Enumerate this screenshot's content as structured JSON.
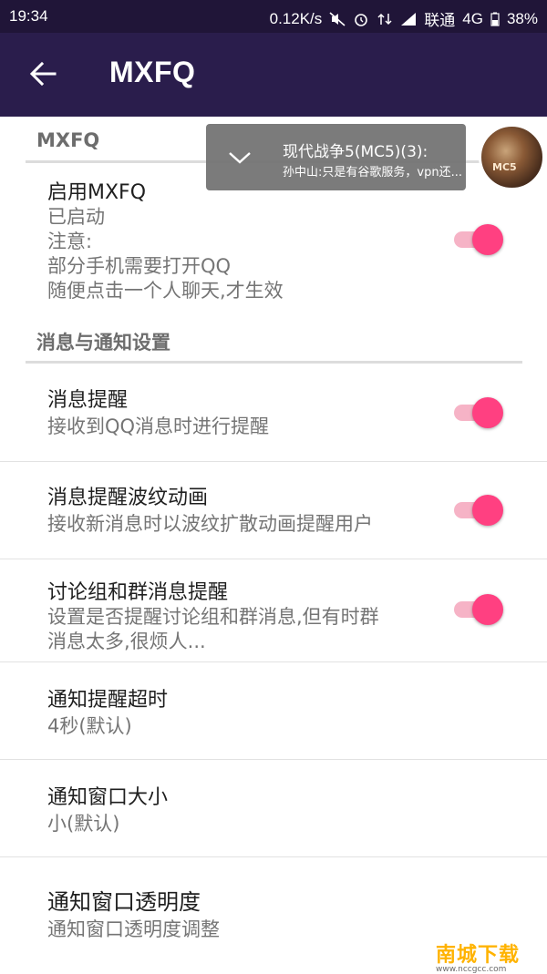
{
  "status_bar": {
    "time": "19:34",
    "net_speed": "0.12K/s",
    "carrier": "联通",
    "network_type": "4G",
    "battery": "38%"
  },
  "app_bar": {
    "title": "MXFQ"
  },
  "notification": {
    "title": "现代战争5(MC5)(3):",
    "message": "孙中山:只是有谷歌服务，vpn还..."
  },
  "sections": [
    {
      "header": "MXFQ",
      "items": [
        {
          "title": "启用MXFQ",
          "summary": "已启动\n注意:\n部分手机需要打开QQ\n随便点击一个人聊天,才生效",
          "toggle": true
        }
      ]
    },
    {
      "header": "消息与通知设置",
      "items": [
        {
          "title": "消息提醒",
          "summary": "接收到QQ消息时进行提醒",
          "toggle": true
        },
        {
          "title": "消息提醒波纹动画",
          "summary": "接收新消息时以波纹扩散动画提醒用户",
          "toggle": true
        },
        {
          "title": "讨论组和群消息提醒",
          "summary": "设置是否提醒讨论组和群消息,但有时群\n消息太多,很烦人...",
          "toggle": true
        },
        {
          "title": "通知提醒超时",
          "summary": "4秒(默认)"
        },
        {
          "title": "通知窗口大小",
          "summary": "小(默认)"
        },
        {
          "title": "通知窗口透明度",
          "summary": "通知窗口透明度调整"
        }
      ]
    }
  ],
  "watermark": {
    "text": "南城下载",
    "url": "www.nccgcc.com"
  },
  "colors": {
    "primary": "#2a1d4c",
    "status_bar": "#201538",
    "accent": "#ff4081"
  }
}
